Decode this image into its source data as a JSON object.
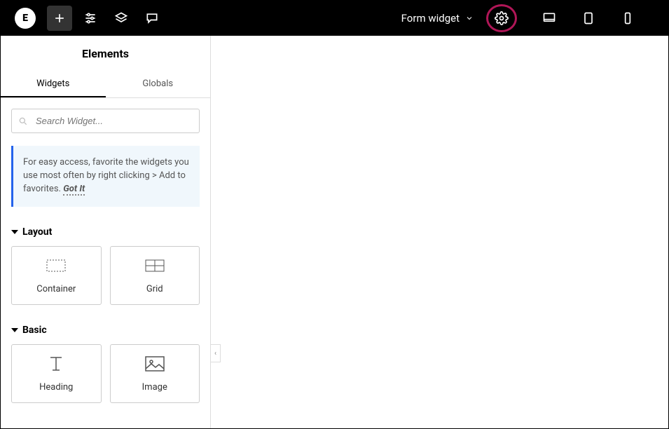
{
  "topbar": {
    "page_title": "Form widget"
  },
  "sidebar": {
    "title": "Elements",
    "tabs": {
      "widgets": "Widgets",
      "globals": "Globals"
    },
    "search_placeholder": "Search Widget...",
    "tip": {
      "text": "For easy access, favorite the widgets you use most often by right clicking > Add to favorites. ",
      "gotit": "Got It"
    },
    "sections": {
      "layout": {
        "label": "Layout",
        "items": {
          "container": "Container",
          "grid": "Grid"
        }
      },
      "basic": {
        "label": "Basic",
        "items": {
          "heading": "Heading",
          "image": "Image"
        }
      }
    }
  }
}
